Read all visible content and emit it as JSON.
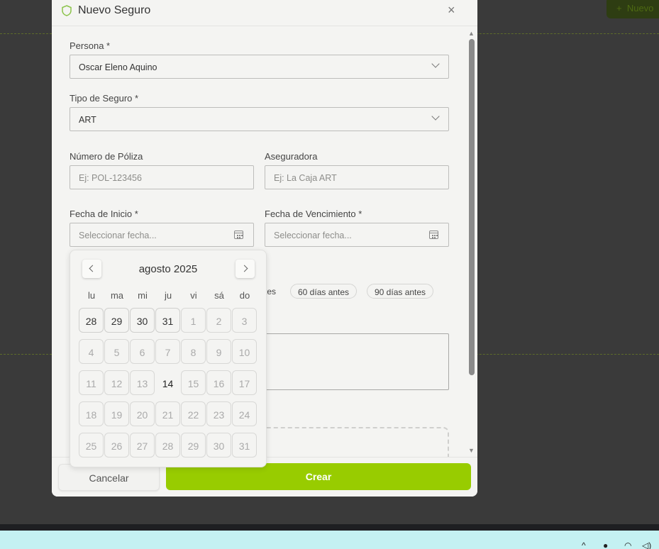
{
  "background": {
    "new_button_label": "Nuevo"
  },
  "modal": {
    "title": "Nuevo Seguro",
    "persona": {
      "label": "Persona *",
      "value": "Oscar Eleno Aquino"
    },
    "tipo": {
      "label": "Tipo de Seguro *",
      "value": "ART"
    },
    "poliza": {
      "label": "Número de Póliza",
      "placeholder": "Ej: POL-123456"
    },
    "aseguradora": {
      "label": "Aseguradora",
      "placeholder": "Ej: La Caja ART"
    },
    "fecha_inicio": {
      "label": "Fecha de Inicio *",
      "placeholder": "Seleccionar fecha..."
    },
    "fecha_venc": {
      "label": "Fecha de Vencimiento *",
      "placeholder": "Seleccionar fecha..."
    },
    "reminder_partial": "tes",
    "chips": [
      "60 días antes",
      "90 días antes"
    ],
    "cancel_label": "Cancelar",
    "create_label": "Crear"
  },
  "calendar": {
    "month_label": "agosto 2025",
    "weekdays": [
      "lu",
      "ma",
      "mi",
      "ju",
      "vi",
      "sá",
      "do"
    ],
    "weeks": [
      [
        "28",
        "29",
        "30",
        "31",
        "1",
        "2",
        "3"
      ],
      [
        "4",
        "5",
        "6",
        "7",
        "8",
        "9",
        "10"
      ],
      [
        "11",
        "12",
        "13",
        "14",
        "15",
        "16",
        "17"
      ],
      [
        "18",
        "19",
        "20",
        "21",
        "22",
        "23",
        "24"
      ],
      [
        "25",
        "26",
        "27",
        "28",
        "29",
        "30",
        "31"
      ]
    ],
    "today": "14"
  },
  "colors": {
    "accent": "#98cc00",
    "shield_icon": "#8bc34a"
  },
  "icons": [
    "shield-icon",
    "close-icon",
    "chevron-down-icon",
    "calendar-icon",
    "chevron-left-icon",
    "chevron-right-icon"
  ]
}
